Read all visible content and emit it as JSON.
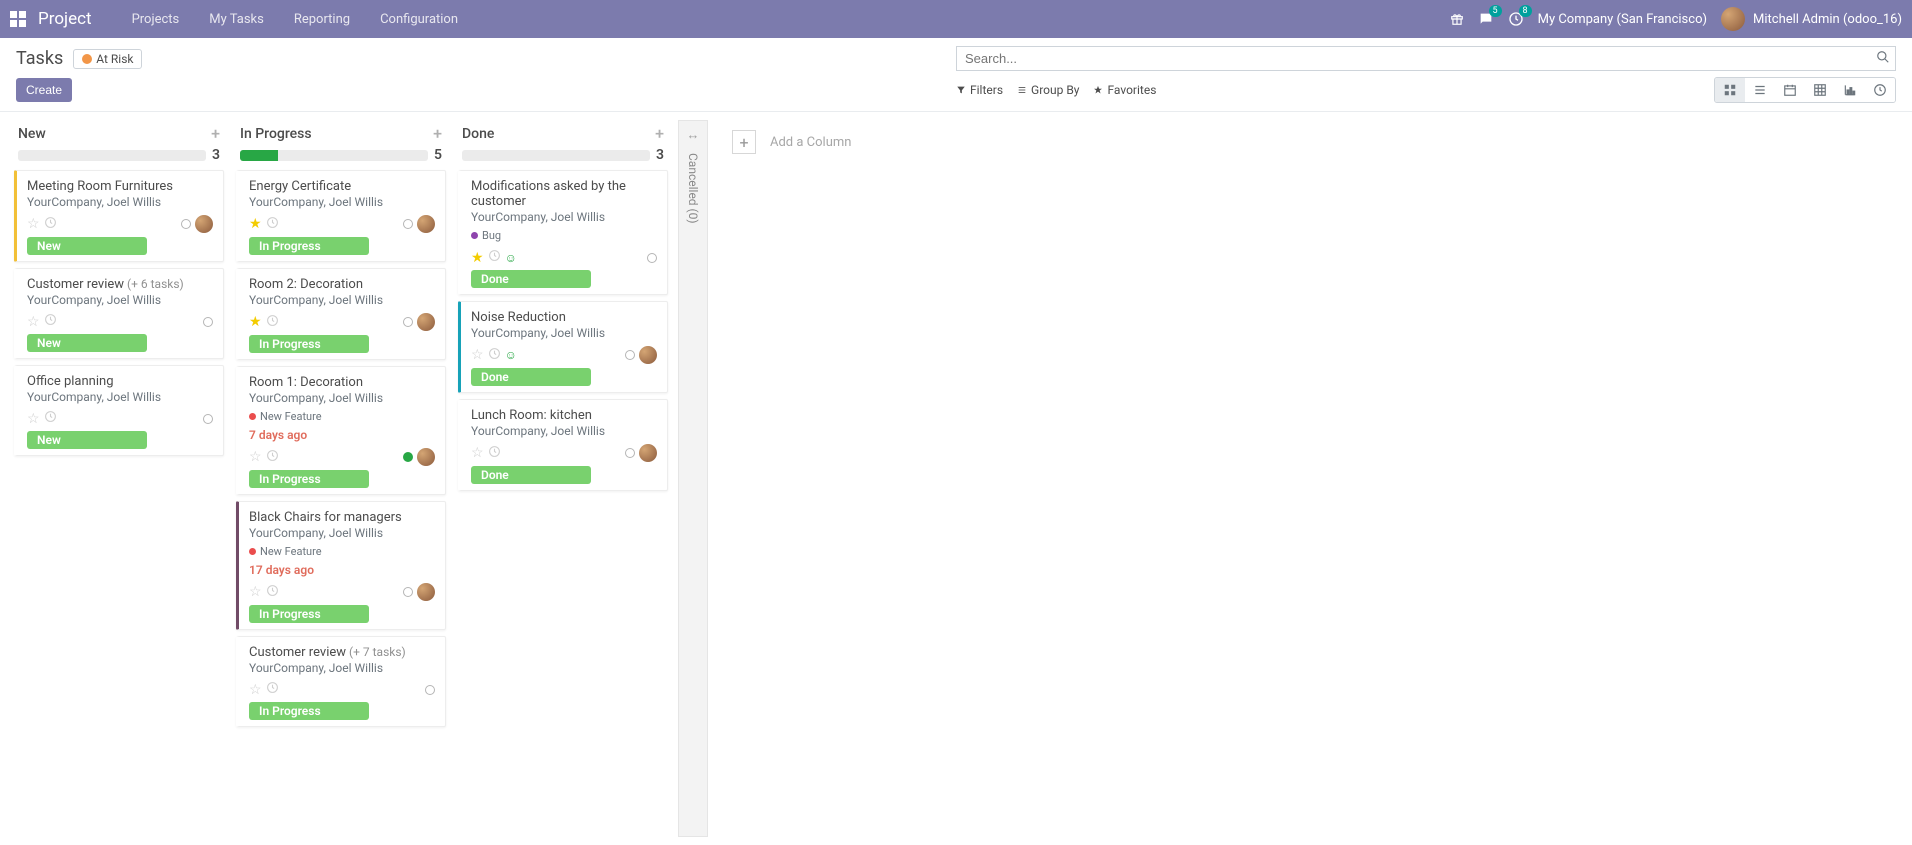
{
  "nav": {
    "brand": "Project",
    "links": [
      "Projects",
      "My Tasks",
      "Reporting",
      "Configuration"
    ],
    "msg_badge": "5",
    "activity_badge": "8",
    "company": "My Company (San Francisco)",
    "user": "Mitchell Admin (odoo_16)"
  },
  "panel": {
    "title": "Tasks",
    "risk_label": "At Risk",
    "search_placeholder": "Search...",
    "create": "Create",
    "filters": "Filters",
    "groupby": "Group By",
    "favorites": "Favorites"
  },
  "columns": [
    {
      "title": "New",
      "count": "3",
      "progress_pct": 0,
      "cards": [
        {
          "title": "Meeting Room Furnitures",
          "subtitle": "YourCompany, Joel Willis",
          "stage": "New",
          "starred": false,
          "accent": "yellow",
          "avatar": true
        },
        {
          "title": "Customer review",
          "subtasks": "(+ 6 tasks)",
          "subtitle": "YourCompany, Joel Willis",
          "stage": "New",
          "starred": false
        },
        {
          "title": "Office planning",
          "subtitle": "YourCompany, Joel Willis",
          "stage": "New",
          "starred": false
        }
      ]
    },
    {
      "title": "In Progress",
      "count": "5",
      "progress_pct": 20,
      "cards": [
        {
          "title": "Energy Certificate",
          "subtitle": "YourCompany, Joel Willis",
          "stage": "In Progress",
          "starred": true,
          "avatar": true
        },
        {
          "title": "Room 2: Decoration",
          "subtitle": "YourCompany, Joel Willis",
          "stage": "In Progress",
          "starred": true,
          "avatar": true
        },
        {
          "title": "Room 1: Decoration",
          "subtitle": "YourCompany, Joel Willis",
          "tag": "New Feature",
          "tag_color": "red",
          "date": "7 days ago",
          "stage": "In Progress",
          "starred": false,
          "avatar": true,
          "state": "green"
        },
        {
          "title": "Black Chairs for managers",
          "subtitle": "YourCompany, Joel Willis",
          "tag": "New Feature",
          "tag_color": "red",
          "date": "17 days ago",
          "stage": "In Progress",
          "starred": false,
          "avatar": true,
          "accent": "purple"
        },
        {
          "title": "Customer review",
          "subtasks": "(+ 7 tasks)",
          "subtitle": "YourCompany, Joel Willis",
          "stage": "In Progress",
          "starred": false
        }
      ]
    },
    {
      "title": "Done",
      "count": "3",
      "progress_pct": 0,
      "cards": [
        {
          "title": "Modifications asked by the customer",
          "subtitle": "YourCompany, Joel Willis",
          "tag": "Bug",
          "tag_color": "purple",
          "stage": "Done",
          "starred": true,
          "smile": true
        },
        {
          "title": "Noise Reduction",
          "subtitle": "YourCompany, Joel Willis",
          "stage": "Done",
          "starred": false,
          "smile": true,
          "avatar": true,
          "accent": "blue"
        },
        {
          "title": "Lunch Room: kitchen",
          "subtitle": "YourCompany, Joel Willis",
          "stage": "Done",
          "starred": false,
          "avatar": true
        }
      ]
    }
  ],
  "folded": {
    "title": "Cancelled (0)"
  },
  "add_column": "Add a Column"
}
